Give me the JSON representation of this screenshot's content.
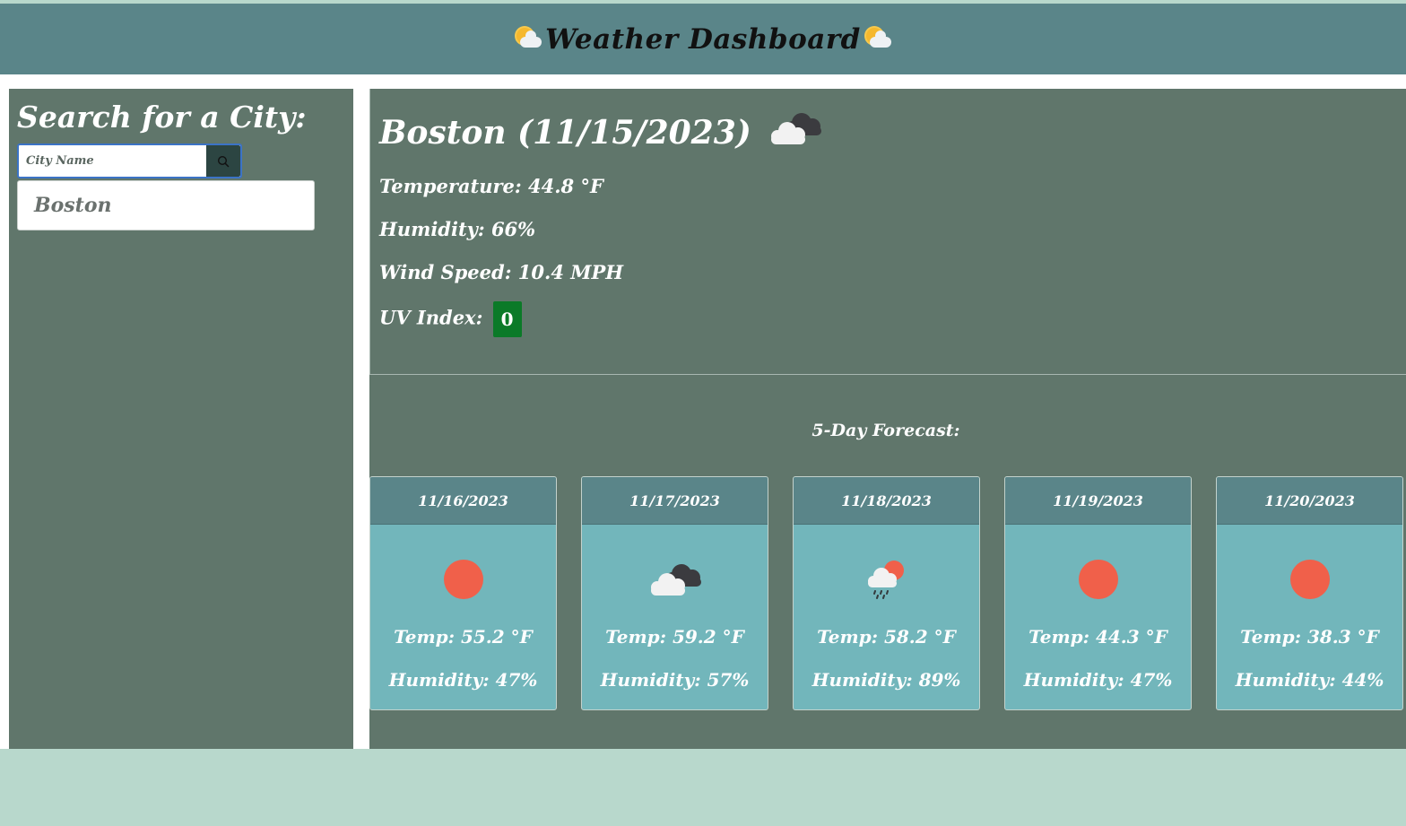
{
  "header": {
    "title": "Weather Dashboard",
    "left_icon": "sun-behind-cloud-icon",
    "right_icon": "sun-behind-cloud-icon"
  },
  "sidebar": {
    "title": "Search for a City:",
    "search": {
      "placeholder": "City Name",
      "value": "",
      "button_icon": "search-icon"
    },
    "history": [
      {
        "label": "Boston"
      }
    ]
  },
  "current": {
    "title": "Boston (11/15/2023)",
    "icon": "clouds-icon",
    "temperature_label": "Temperature:",
    "temperature_value": "44.8 °F",
    "humidity_label": "Humidity:",
    "humidity_value": "66%",
    "wind_label": "Wind Speed:",
    "wind_value": "10.4 MPH",
    "uv_label": "UV Index:",
    "uv_value": "0",
    "uv_color": "#0b7a28"
  },
  "forecast": {
    "title": "5-Day Forecast:",
    "temp_label": "Temp:",
    "humidity_label": "Humidity:",
    "days": [
      {
        "date": "11/16/2023",
        "icon": "sun-icon",
        "temp": "55.2 °F",
        "humidity": "47%"
      },
      {
        "date": "11/17/2023",
        "icon": "clouds-icon",
        "temp": "59.2 °F",
        "humidity": "57%"
      },
      {
        "date": "11/18/2023",
        "icon": "rain-sun-icon",
        "temp": "58.2 °F",
        "humidity": "89%"
      },
      {
        "date": "11/19/2023",
        "icon": "sun-icon",
        "temp": "44.3 °F",
        "humidity": "47%"
      },
      {
        "date": "11/20/2023",
        "icon": "sun-icon",
        "temp": "38.3 °F",
        "humidity": "44%"
      }
    ]
  },
  "colors": {
    "header_bg": "#5a8589",
    "panel_bg": "#60766b",
    "card_bg": "#72b6bb",
    "sun": "#f0604a"
  }
}
